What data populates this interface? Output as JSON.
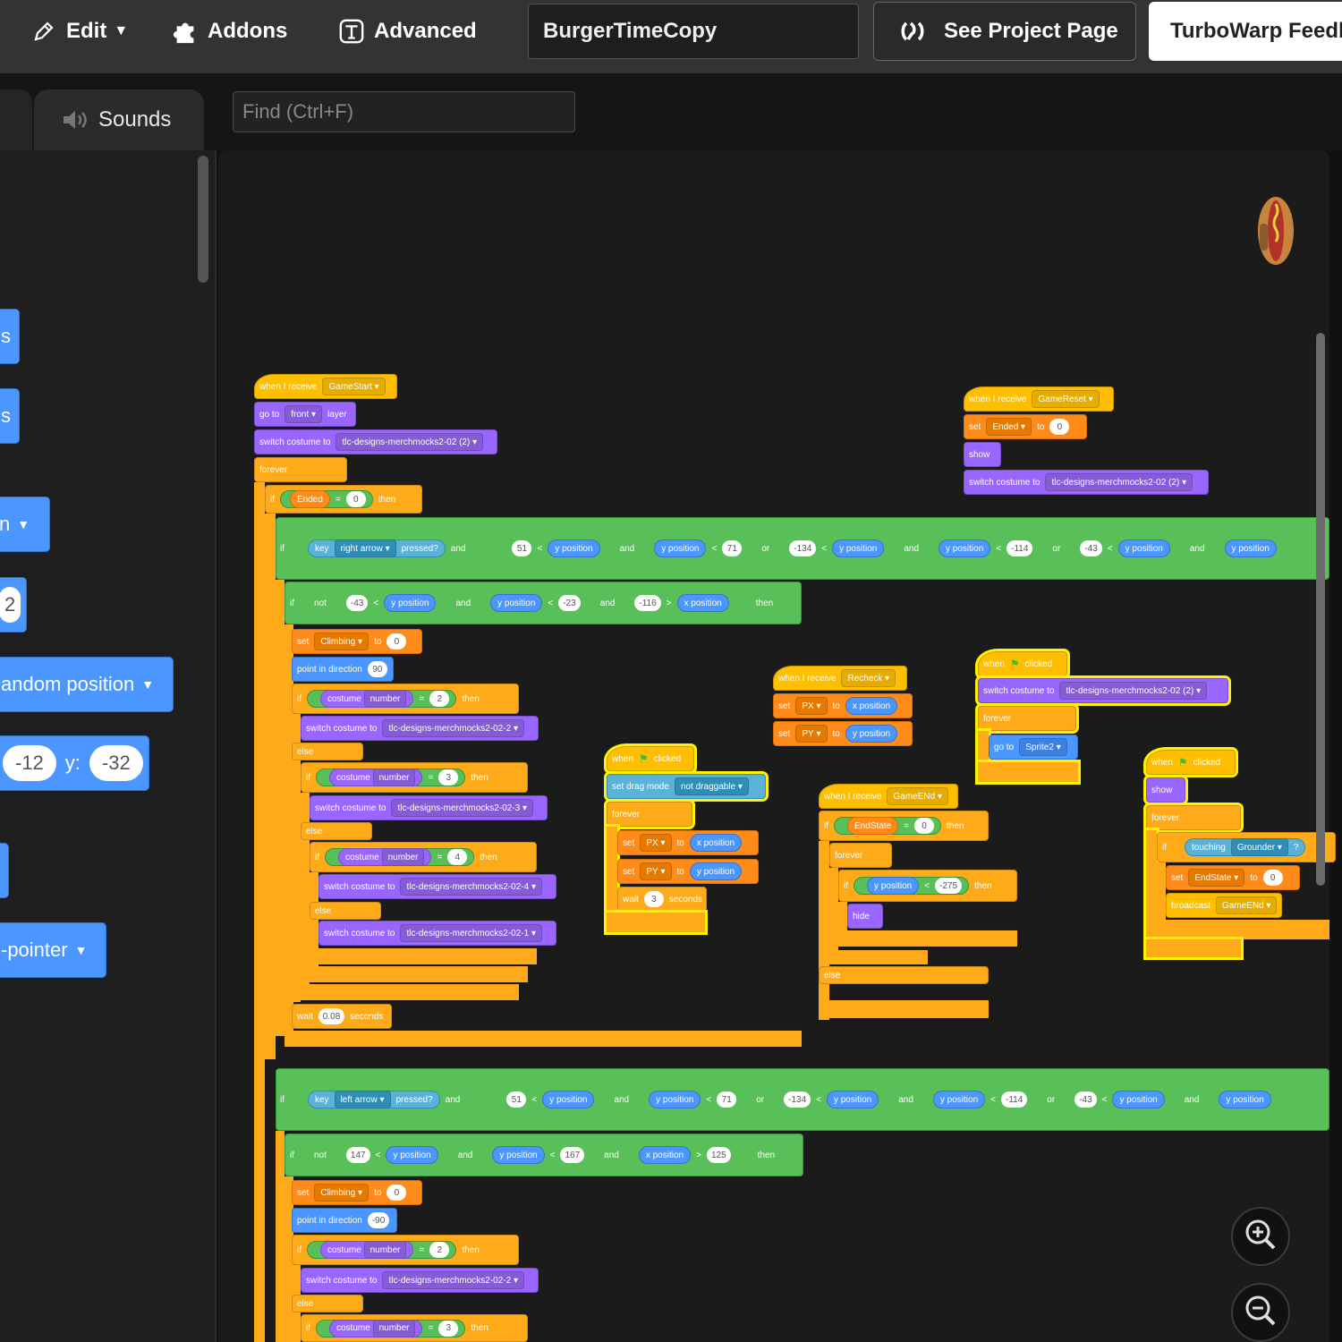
{
  "menu": {
    "edit_label": "Edit",
    "addons_label": "Addons",
    "advanced_label": "Advanced",
    "project_title": "BurgerTimeCopy",
    "see_project_label": "See Project Page",
    "feedback_label": "TurboWarp Feedb"
  },
  "tabs": {
    "sounds_label": "Sounds"
  },
  "search": {
    "placeholder": "Find (Ctrl+F)"
  },
  "palette": {
    "b1": "s",
    "b2": "s",
    "b3": "n",
    "b4": "2",
    "b5": "andom position",
    "b6_x": "-12",
    "b6_y_label": "y:",
    "b6_y": "-32",
    "b7": "-pointer"
  },
  "scripts": {
    "s1": {
      "hat": "when I receive",
      "hat_msg": "GameStart",
      "goto": "go to",
      "goto_dd": "front",
      "layer": "layer",
      "switch": "switch costume to",
      "costume": "tlc-designs-merchmocks2-02 (2)",
      "forever": "forever",
      "if": "if",
      "ended": "Ended",
      "eq": "=",
      "zero": "0",
      "then": "then",
      "key": "key",
      "right": "right arrow",
      "pressed": "pressed?",
      "and": "and",
      "or": "or",
      "ypos": "y position",
      "xpos": "x position",
      "n51": "51",
      "lt": "<",
      "n71": "71",
      "n134": "-134",
      "n114": "-114",
      "n43": "-43",
      "not": "not",
      "n23": "-23",
      "n116": "-116",
      "gt": ">",
      "set": "set",
      "climbing": "Climbing",
      "to": "to",
      "point": "point in direction",
      "n90": "90",
      "costume_dd": "costume",
      "number": "number",
      "n2": "2",
      "n3": "3",
      "n4": "4",
      "c22": "tlc-designs-merchmocks2-02-2",
      "c23": "tlc-designs-merchmocks2-02-3",
      "c24": "tlc-designs-merchmocks2-02-4",
      "c21": "tlc-designs-merchmocks2-02-1",
      "else": "else",
      "wait": "wait",
      "n008": "0.08",
      "seconds": "seconds",
      "left": "left arrow",
      "n147": "147",
      "n167": "167",
      "n125": "125",
      "nm90": "-90"
    },
    "s2": {
      "hat": "when I receive",
      "msg": "GameReset",
      "set": "set",
      "var": "Ended",
      "to": "to",
      "val": "0",
      "show": "show",
      "switch": "switch costume to",
      "costume": "tlc-designs-merchmocks2-02 (2)"
    },
    "s3": {
      "hat": "when I receive",
      "msg": "Recheck",
      "set": "set",
      "px": "PX",
      "py": "PY",
      "to": "to",
      "xpos": "x position",
      "ypos": "y position"
    },
    "s4": {
      "when": "when",
      "clicked": "clicked",
      "switch": "switch costume to",
      "costume": "tlc-designs-merchmocks2-02 (2)",
      "forever": "forever",
      "goto": "go to",
      "sprite": "Sprite2"
    },
    "s5": {
      "when": "when",
      "clicked": "clicked",
      "drag": "set drag mode",
      "drag_dd": "not draggable",
      "forever": "forever",
      "set": "set",
      "px": "PX",
      "py": "PY",
      "to": "to",
      "xpos": "x position",
      "ypos": "y position",
      "wait": "wait",
      "n3": "3",
      "seconds": "seconds"
    },
    "s6": {
      "hat": "when I receive",
      "msg": "GameENd",
      "if": "if",
      "endstate": "EndState",
      "eq": "=",
      "zero": "0",
      "then": "then",
      "forever": "forever",
      "ypos": "y position",
      "lt": "<",
      "n275": "-275",
      "hide": "hide",
      "else": "else"
    },
    "s7": {
      "when": "when",
      "clicked": "clicked",
      "show": "show",
      "forever": "forever",
      "if": "if",
      "touching": "touching",
      "grounder": "Grounder",
      "q": "?",
      "set": "set",
      "endstate": "EndState",
      "to": "to",
      "zero": "0",
      "broadcast": "broadcast",
      "msg": "GameENd"
    }
  },
  "colors": {
    "events": "#ffbf00",
    "looks": "#9966ff",
    "motion": "#4c97ff",
    "control": "#ffab19",
    "operators": "#59c059",
    "variables": "#ff8c1a",
    "sensing": "#5cb1d6"
  }
}
